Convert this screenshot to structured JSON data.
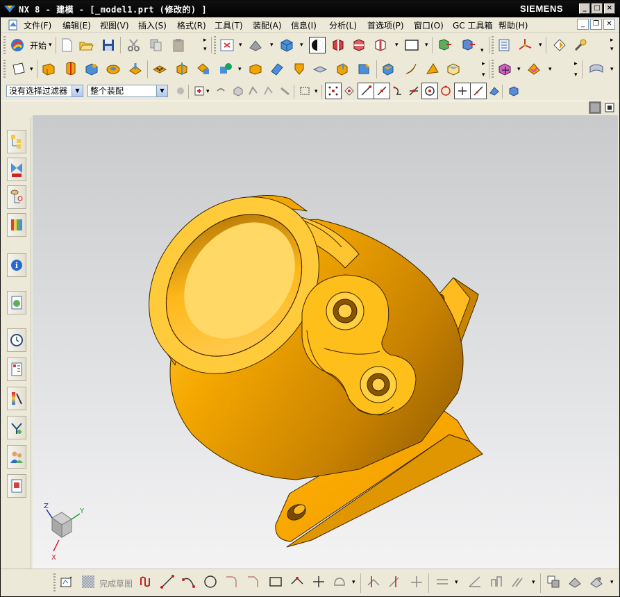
{
  "window": {
    "title": "NX 8 - 建模 - [_model1.prt  (修改的) ]",
    "brand": "SIEMENS",
    "minimize": "_",
    "maximize": "□",
    "close": "×"
  },
  "menu": {
    "items": [
      "文件(F)",
      "编辑(E)",
      "视图(V)",
      "插入(S)",
      "格式(R)",
      "工具(T)",
      "装配(A)",
      "信息(I)",
      "分析(L)",
      "首选项(P)",
      "窗口(O)",
      "GC 工具箱",
      "帮助(H)"
    ]
  },
  "toolbar": {
    "start_label": "开始",
    "start_dropdown": "▾"
  },
  "selection_bar": {
    "filter_value": "没有选择过滤器",
    "scope_value": "整个装配"
  },
  "bottom_toolbar": {
    "finish_sketch_label": "完成草图"
  },
  "triad": {
    "x_label": "X",
    "y_label": "Y",
    "z_label": "Z"
  },
  "colors": {
    "part_color": "#f2a400",
    "part_shadow": "#b87500",
    "part_highlight": "#ffd24a",
    "titlebar": "#000000",
    "chrome": "#ece9d8"
  }
}
